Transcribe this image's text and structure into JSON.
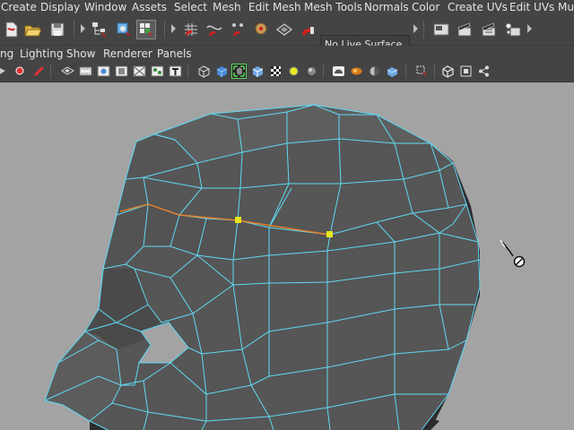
{
  "menubar": {
    "items": [
      "Create",
      "Display",
      "Window",
      "Assets",
      "Select",
      "Mesh",
      "Edit Mesh",
      "Mesh Tools",
      "Normals",
      "Color",
      "Create UVs",
      "Edit UVs",
      "Mu"
    ]
  },
  "toolbar": {
    "live_surface": "No Live Surface"
  },
  "panel_menu": {
    "items": [
      "ng",
      "Lighting",
      "Show",
      "Renderer",
      "Panels"
    ]
  },
  "colors": {
    "ui_bg": "#444444",
    "viewport_bg": "#a3a3a3",
    "wire": "#5fd9f2",
    "edge_selected": "#e8822a",
    "vertex_selected": "#e6e61a",
    "mesh_face": "#555555"
  },
  "icons": [
    "new-scene-icon",
    "open-scene-icon",
    "save-scene-icon",
    "select-by-hierarchy-icon",
    "select-by-object-icon",
    "select-by-component-icon",
    "snap-to-grid-icon",
    "snap-to-curve-icon",
    "snap-to-point-icon",
    "snap-to-projected-center-icon",
    "snap-to-view-plane-icon",
    "make-live-icon",
    "render-view-icon",
    "render-icon",
    "ipr-render-icon",
    "render-settings-icon"
  ],
  "viewport": {
    "label": "3D viewport - head mesh wireframe"
  }
}
